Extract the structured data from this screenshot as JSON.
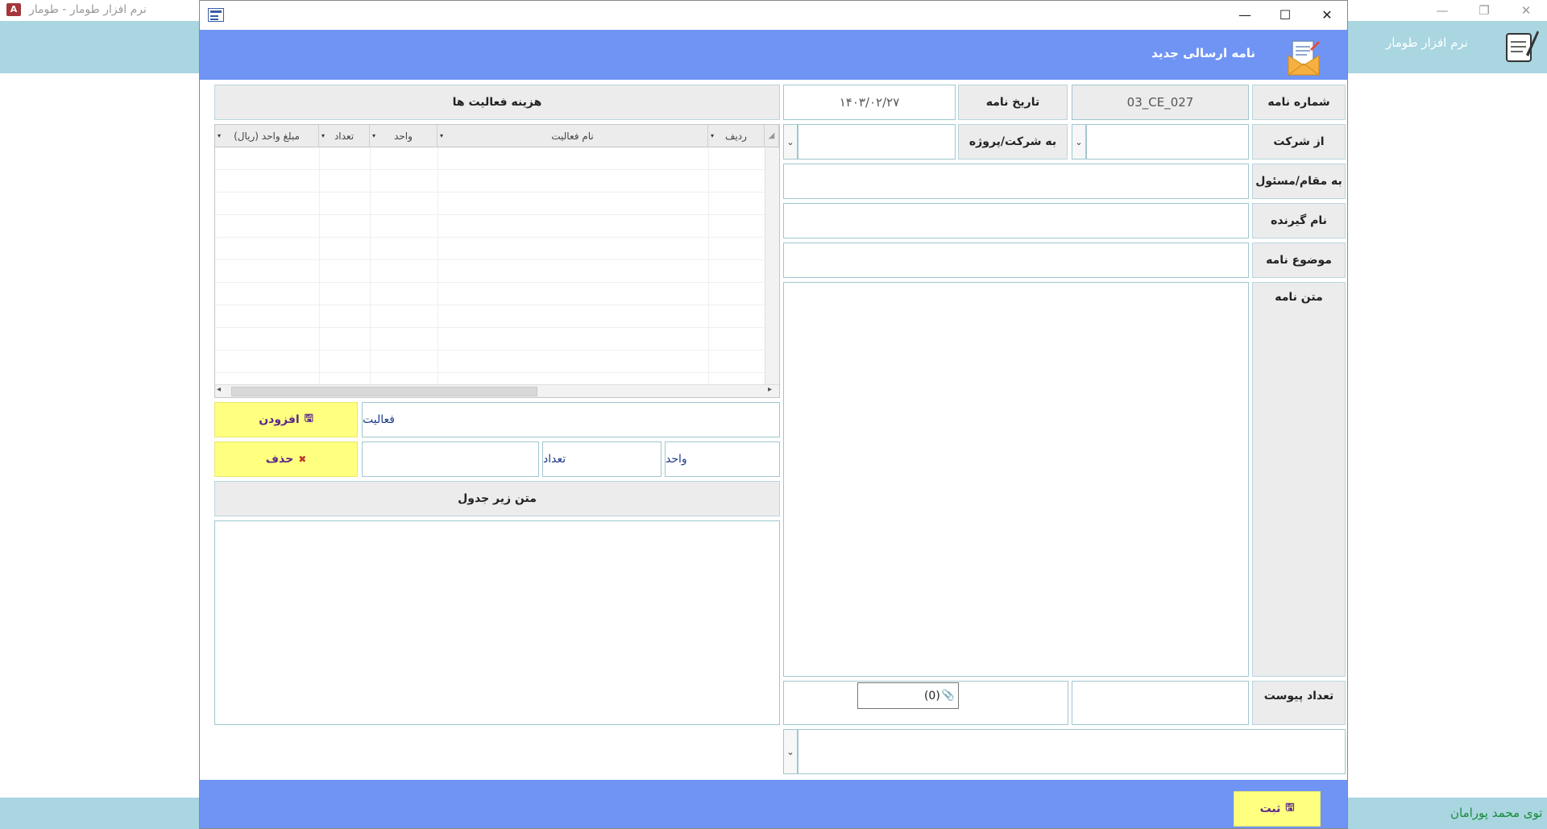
{
  "background_app": {
    "title": "نرم افزار طومار - طومار",
    "app_icon": "A",
    "header_title": "نرم افزار طومار",
    "footer_user": "توی محمد پورامان"
  },
  "dialog": {
    "window_controls": {
      "minimize": "—",
      "maximize": "☐",
      "close": "✕"
    },
    "header_title": "نامه ارسالی جدید",
    "fields": {
      "letter_number_label": "شماره نامه",
      "letter_number_value": "03_CE_027",
      "letter_date_label": "تاریخ نامه",
      "letter_date_value": "۱۴۰۳/۰۲/۲۷",
      "from_company_label": "از شرکت",
      "to_company_label": "به شرکت/پروژه",
      "to_position_label": "به مقام/مسئول",
      "recipient_name_label": "نام گیرنده",
      "subject_label": "موضوع نامه",
      "body_label": "متن نامه",
      "attachments_label": "تعداد پیوست",
      "attachments_value": "(0)"
    },
    "activities": {
      "section_title": "هزینه فعالیت ها",
      "columns": [
        "ردیف",
        "نام فعالیت",
        "واحد",
        "تعداد",
        "مبلغ واحد (ریال)"
      ],
      "activity_label": "فعالیت",
      "unit_label": "واحد",
      "count_label": "تعداد",
      "add_button": "افزودن",
      "delete_button": "حذف",
      "below_table_title": "متن  زیر جدول"
    },
    "submit_button": "ثبت"
  }
}
